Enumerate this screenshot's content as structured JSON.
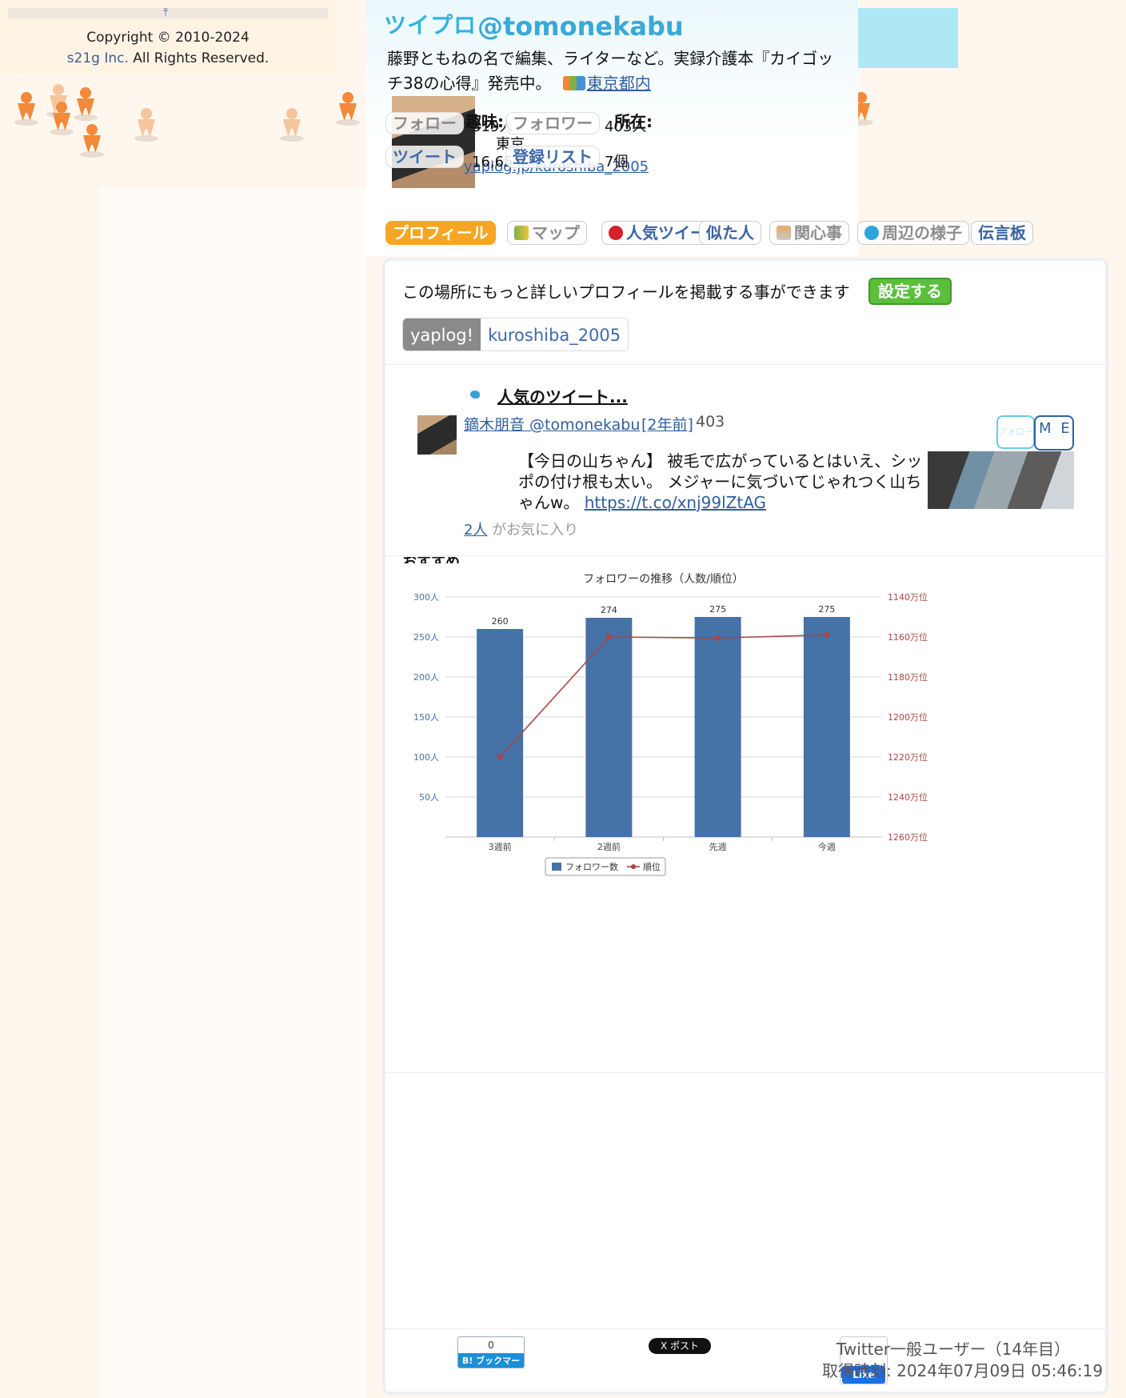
{
  "nav": {
    "scroll_top_icon": "arrow-up-to-top-icon"
  },
  "copyright": {
    "text": "Copyright © 2010-2024",
    "company": "s21g Inc.",
    "rights": "All Rights Reserved."
  },
  "header": {
    "logo": "ツイプロ",
    "handle": "@tomonekabu",
    "bio": "藤野ともねの名で編集、ライターなど。実録介護本『カイゴッチ38の心得』発売中。",
    "location_link": "東京都内",
    "stats": {
      "follow_label": "フォロー",
      "follow_value": "319人",
      "follower_label": "フォロワー",
      "follower_value": "403人",
      "tweet_label": "ツイート",
      "tweet_value": "16,65",
      "list_label": "登録リスト",
      "list_value": "7個",
      "hobby_label": "趣味:",
      "location_label": "所在:",
      "location_value": "東京",
      "yaplog_link": "yaplog.jp/kuroshiba_2005"
    }
  },
  "tabs": [
    {
      "label": "プロフィール",
      "icon": ""
    },
    {
      "label": "マップ",
      "icon": "map-icon"
    },
    {
      "label": "人気ツイート",
      "icon": "heart-icon"
    },
    {
      "label": "似た人",
      "icon": ""
    },
    {
      "label": "関心事",
      "icon": "interest-icon"
    },
    {
      "label": "周辺の様子",
      "icon": "speech-bubble-icon"
    },
    {
      "label": "伝言板",
      "icon": ""
    }
  ],
  "profile": {
    "promo_text": "この場所にもっと詳しいプロフィールを掲載する事ができます",
    "setup_button": "設定する",
    "service_key": "yaplog!",
    "service_value": "kuroshiba_2005"
  },
  "popular": {
    "title": "人気のツイート...",
    "user": "鏑木朋音 @tomonekabu",
    "ago": "[2年前]",
    "count": "403",
    "follow_small": "フォロー",
    "me_label": "M E",
    "text": "【今日の山ちゃん】 被毛で広がっているとはいえ、シッポの付け根も太い。 メジャーに気づいてじゃれつく山ちゃんw。",
    "link": "https://t.co/xnj99lZtAG",
    "likes_link": "2人",
    "likes_text": "がお気に入り",
    "cut_heading": "おすすめ..."
  },
  "chart_data": {
    "type": "bar",
    "title": "フォロワーの推移（人数/順位）",
    "categories": [
      "3週前",
      "2週前",
      "先週",
      "今週"
    ],
    "series": [
      {
        "name": "フォロワー数",
        "type": "bar",
        "values": [
          260,
          274,
          275,
          275
        ],
        "color": "#4572a7"
      },
      {
        "name": "順位",
        "type": "line",
        "values": [
          1220,
          1160,
          1160.5,
          1159
        ],
        "color": "#aa4643"
      }
    ],
    "ylim_left": [
      0,
      300
    ],
    "ylim_right": [
      1260,
      1140
    ],
    "left_ticks": [
      "300人",
      "250人",
      "200人",
      "150人",
      "100人",
      "50人"
    ],
    "right_ticks": [
      "1140万位",
      "1160万位",
      "1180万位",
      "1200万位",
      "1220万位",
      "1240万位",
      "1260万位"
    ],
    "legend": "bottom-center"
  },
  "footer": {
    "bookmark_count": "0",
    "bookmark_label": "B! ブックマーク",
    "x_post": "X ポスト",
    "like": "Like",
    "user_type": "Twitter一般ユーザー（14年目）",
    "fetched": "取得時刻: 2024年07月09日 05:46:19"
  },
  "colors": {
    "accent": "#f6a623",
    "link": "#2f5f9e",
    "brand": "#31b4e0"
  }
}
